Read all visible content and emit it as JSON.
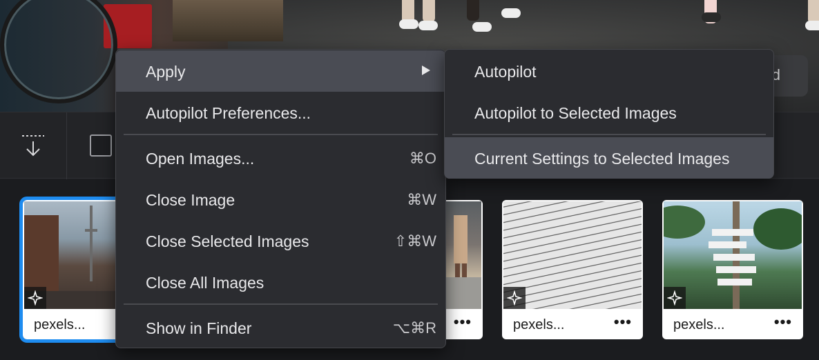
{
  "context_menu": {
    "items": [
      {
        "label": "Apply",
        "shortcut": "",
        "has_submenu": true
      },
      {
        "label": "Autopilot Preferences...",
        "shortcut": ""
      },
      {
        "label": "Open Images...",
        "shortcut": "⌘O"
      },
      {
        "label": "Close Image",
        "shortcut": "⌘W"
      },
      {
        "label": "Close Selected Images",
        "shortcut": "⇧⌘W"
      },
      {
        "label": "Close All Images",
        "shortcut": ""
      },
      {
        "label": "Show in Finder",
        "shortcut": "⌥⌘R"
      }
    ]
  },
  "submenu": {
    "items": [
      {
        "label": "Autopilot"
      },
      {
        "label": "Autopilot to Selected Images"
      },
      {
        "label": "Current Settings to Selected Images"
      }
    ]
  },
  "top_bar": {
    "button_partial": "d"
  },
  "filmstrip": {
    "thumbs": [
      {
        "name": "pexels...",
        "more": "•••",
        "icon": "sparkle-icon"
      },
      {
        "name": "",
        "more": "•••",
        "icon": ""
      },
      {
        "name": "pexels...",
        "more": "•••",
        "icon": "sparkle-icon"
      },
      {
        "name": "pexels...",
        "more": "•••",
        "icon": "sparkle-icon"
      }
    ]
  },
  "colors": {
    "selection": "#1e8cf0",
    "menu_bg": "#2b2c30",
    "menu_highlight": "#4a4c54"
  }
}
